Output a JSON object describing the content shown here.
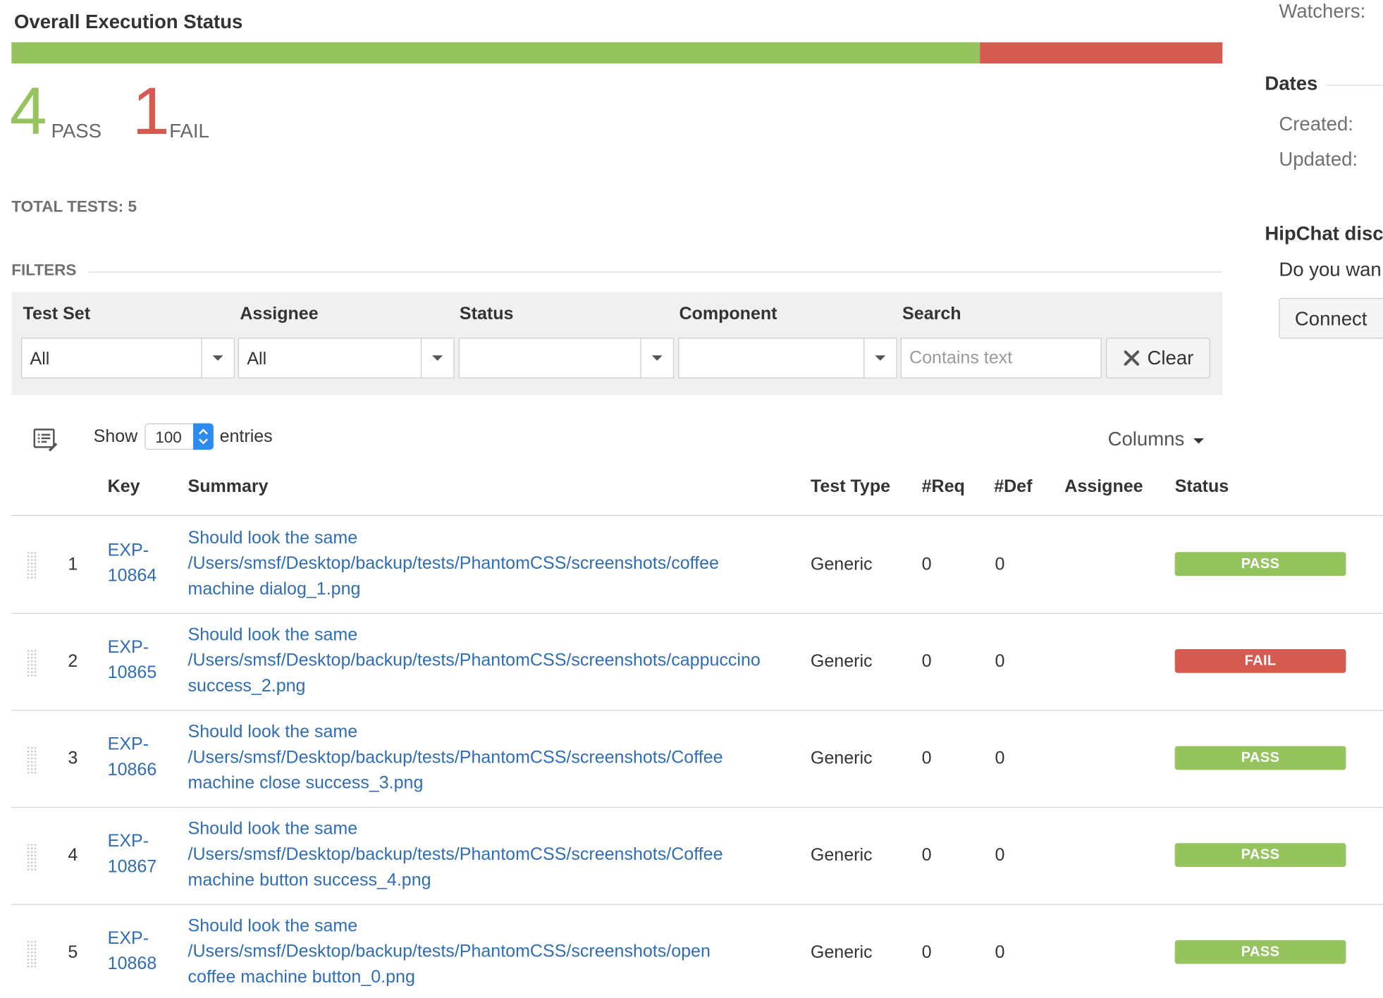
{
  "execution": {
    "title": "Overall Execution Status",
    "pass_fraction": 0.8,
    "pass_count": "4",
    "pass_label": "PASS",
    "fail_count": "1",
    "fail_label": "FAIL",
    "total_tests": "TOTAL TESTS: 5",
    "colors": {
      "pass": "#95c35e",
      "fail": "#d55a4f"
    }
  },
  "filters": {
    "heading": "FILTERS",
    "test_set": {
      "label": "Test Set",
      "value": "All"
    },
    "assignee": {
      "label": "Assignee",
      "value": "All"
    },
    "status": {
      "label": "Status",
      "value": ""
    },
    "component": {
      "label": "Component",
      "value": ""
    },
    "search": {
      "label": "Search",
      "placeholder": "Contains text",
      "value": ""
    },
    "clear_label": "Clear"
  },
  "table_controls": {
    "show_label": "Show",
    "page_length": "100",
    "entries_label": "entries",
    "columns_label": "Columns"
  },
  "table": {
    "headers": [
      "Key",
      "Summary",
      "Test Type",
      "#Req",
      "#Def",
      "Assignee",
      "Status"
    ],
    "rows": [
      {
        "num": "1",
        "key_line1": "EXP-",
        "key_line2": "10864",
        "summary": [
          "Should look the same",
          "/Users/smsf/Desktop/backup/tests/PhantomCSS/screenshots/coffee",
          "machine dialog_1.png"
        ],
        "type": "Generic",
        "req": "0",
        "def": "0",
        "assignee": "",
        "status": "PASS"
      },
      {
        "num": "2",
        "key_line1": "EXP-",
        "key_line2": "10865",
        "summary": [
          "Should look the same",
          "/Users/smsf/Desktop/backup/tests/PhantomCSS/screenshots/cappuccino",
          "success_2.png"
        ],
        "type": "Generic",
        "req": "0",
        "def": "0",
        "assignee": "",
        "status": "FAIL"
      },
      {
        "num": "3",
        "key_line1": "EXP-",
        "key_line2": "10866",
        "summary": [
          "Should look the same",
          "/Users/smsf/Desktop/backup/tests/PhantomCSS/screenshots/Coffee",
          "machine close success_3.png"
        ],
        "type": "Generic",
        "req": "0",
        "def": "0",
        "assignee": "",
        "status": "PASS"
      },
      {
        "num": "4",
        "key_line1": "EXP-",
        "key_line2": "10867",
        "summary": [
          "Should look the same",
          "/Users/smsf/Desktop/backup/tests/PhantomCSS/screenshots/Coffee",
          "machine button success_4.png"
        ],
        "type": "Generic",
        "req": "0",
        "def": "0",
        "assignee": "",
        "status": "PASS"
      },
      {
        "num": "5",
        "key_line1": "EXP-",
        "key_line2": "10868",
        "summary": [
          "Should look the same",
          "/Users/smsf/Desktop/backup/tests/PhantomCSS/screenshots/open",
          "coffee machine button_0.png"
        ],
        "type": "Generic",
        "req": "0",
        "def": "0",
        "assignee": "",
        "status": "PASS"
      }
    ]
  },
  "sidebar": {
    "watchers_label": "Watchers:",
    "dates_heading": "Dates",
    "created_label": "Created:",
    "updated_label": "Updated:",
    "hipchat_heading": "HipChat disc",
    "hipchat_text": "Do you wan",
    "connect_label": "Connect"
  }
}
